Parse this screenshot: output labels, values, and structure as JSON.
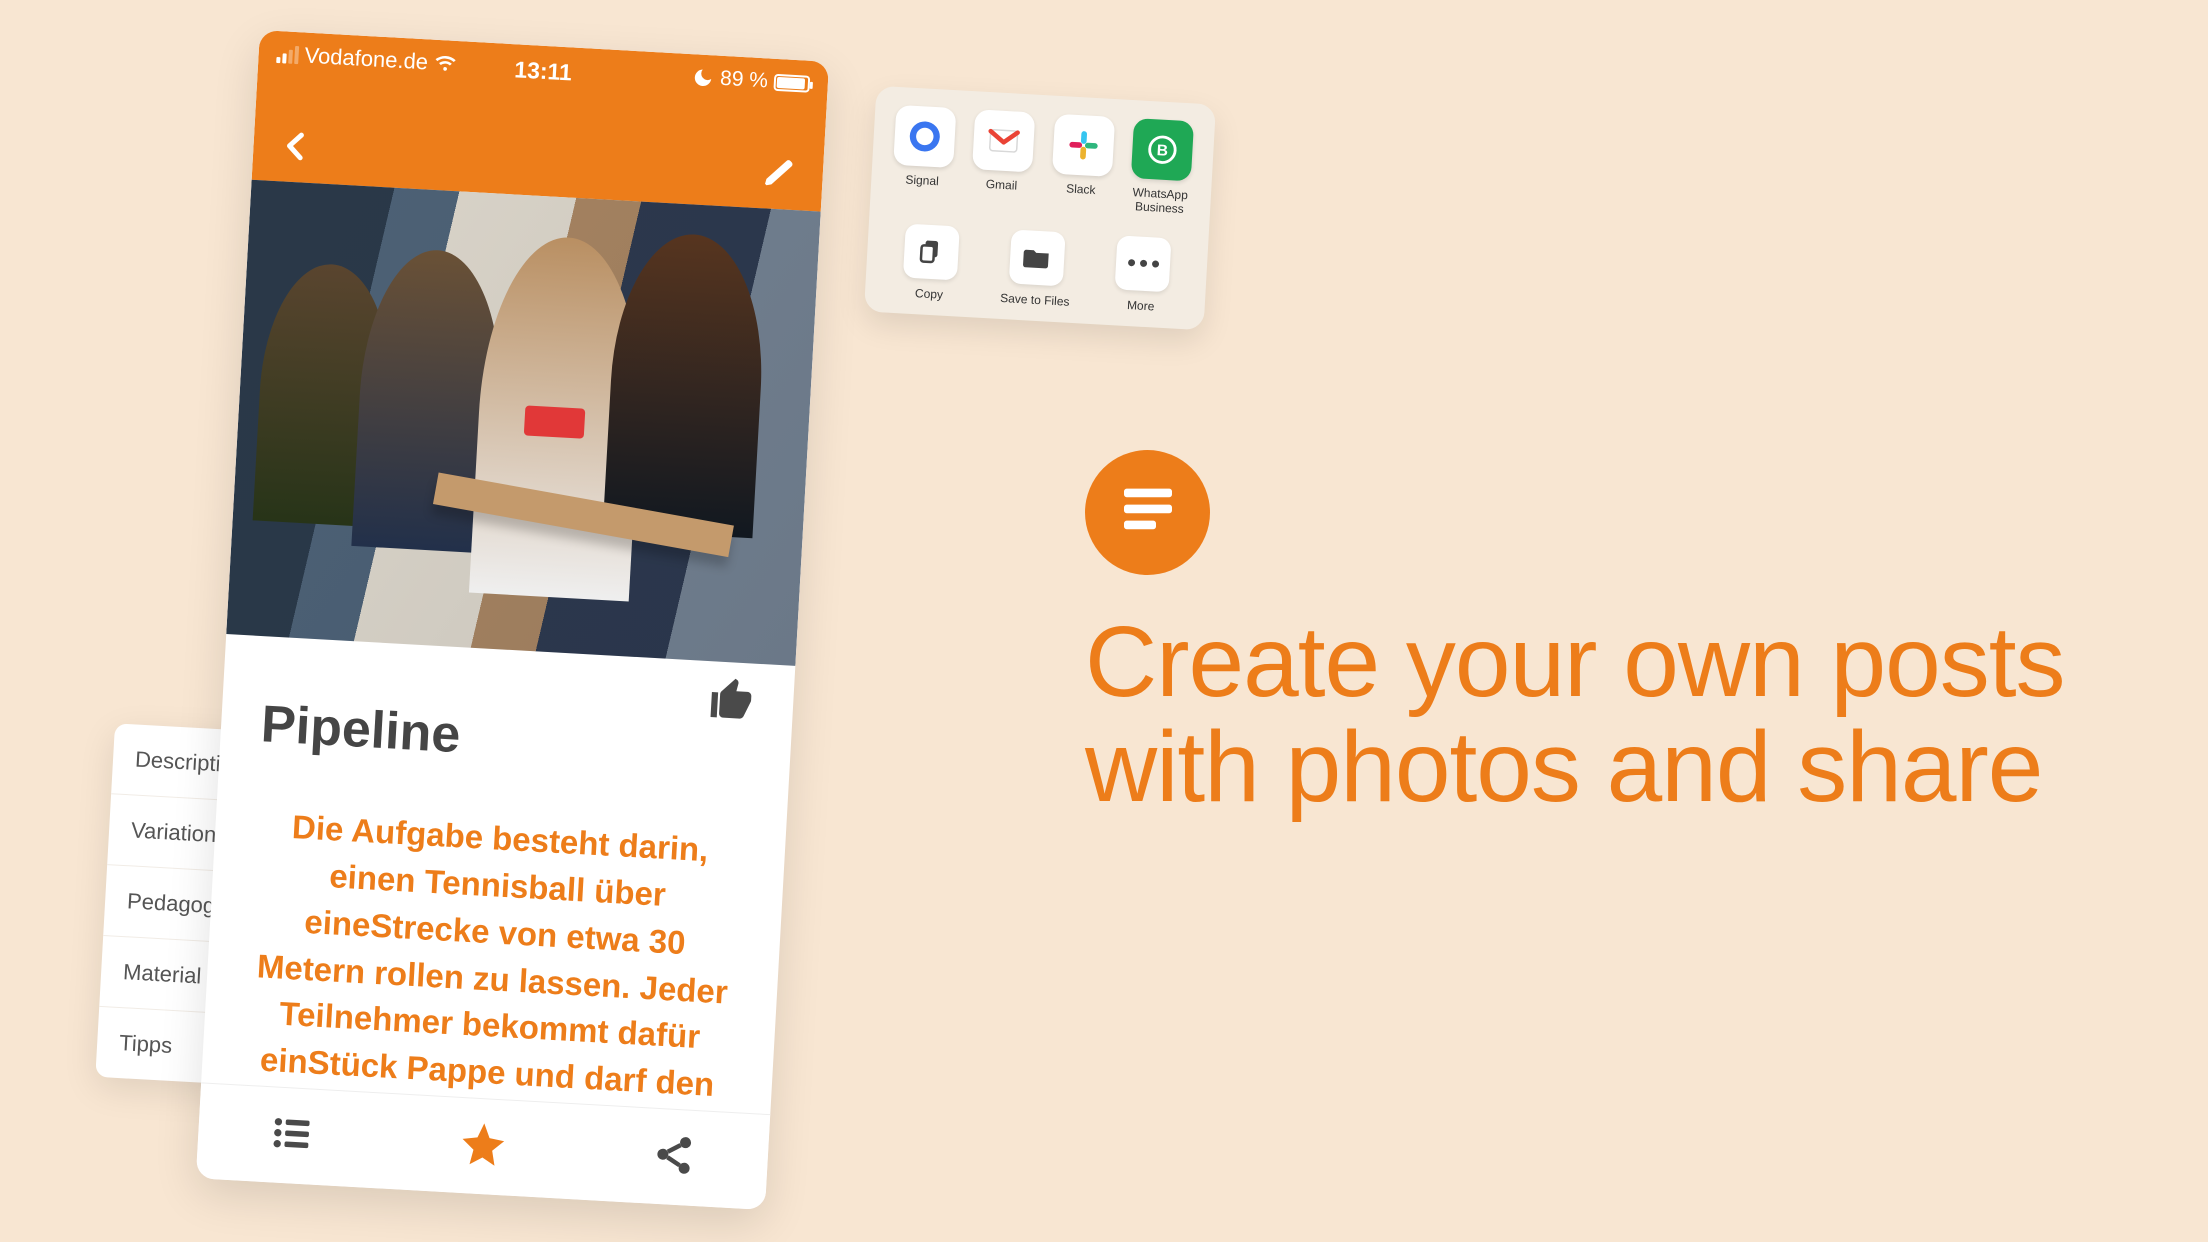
{
  "marketing": {
    "headline_line1": "Create your own posts",
    "headline_line2": "with photos and share",
    "badge_icon": "text-lines-icon"
  },
  "phone": {
    "status": {
      "carrier": "Vodafone.de",
      "time": "13:11",
      "battery_percent": "89 %"
    },
    "nav": {
      "back_icon": "chevron-left-icon",
      "edit_icon": "pencil-icon"
    },
    "post": {
      "title": "Pipeline",
      "like_icon": "thumb-up-icon",
      "description": "Die Aufgabe besteht darin, einen Tennisball über eineStrecke von etwa 30 Metern rollen zu lassen. Jeder Teilnehmer bekommt dafür einStück Pappe und darf den Ball nicht mit den Händen berühren."
    },
    "bottom_bar": {
      "list_icon": "list-icon",
      "star_icon": "star-icon",
      "share_icon": "share-icon"
    }
  },
  "side_list": {
    "items": [
      {
        "label": "Description"
      },
      {
        "label": "Variations"
      },
      {
        "label": "Pedagogy"
      },
      {
        "label": "Material"
      },
      {
        "label": "Tipps"
      }
    ]
  },
  "share_sheet": {
    "apps": [
      {
        "name": "Signal",
        "icon": "signal-icon"
      },
      {
        "name": "Gmail",
        "icon": "gmail-icon"
      },
      {
        "name": "Slack",
        "icon": "slack-icon"
      },
      {
        "name": "WhatsApp Business",
        "icon": "whatsapp-business-icon"
      }
    ],
    "actions": [
      {
        "name": "Copy",
        "icon": "copy-icon"
      },
      {
        "name": "Save to Files",
        "icon": "folder-icon"
      },
      {
        "name": "More",
        "icon": "more-icon"
      }
    ]
  }
}
